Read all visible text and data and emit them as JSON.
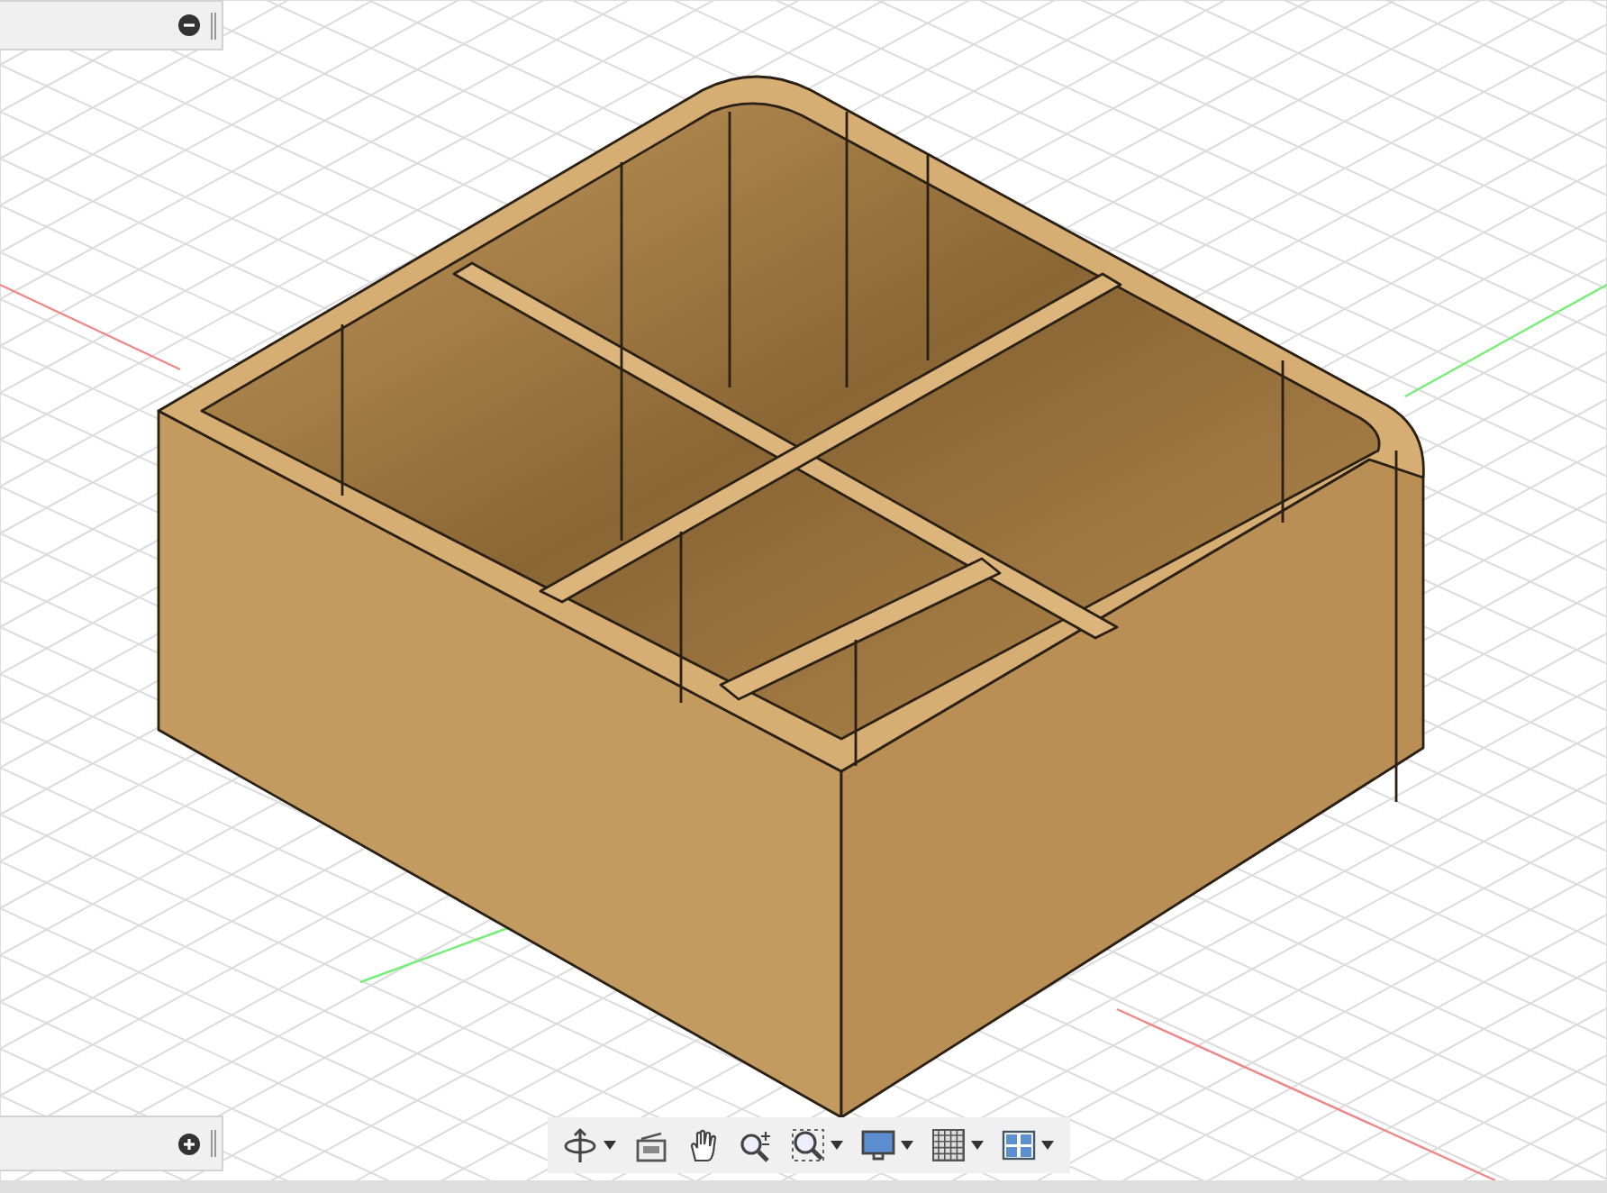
{
  "panels": [
    {
      "expanded": true
    },
    {
      "expanded": false
    }
  ],
  "toolbar": {
    "tools": [
      {
        "kind": "orbit",
        "has_menu": true
      },
      {
        "kind": "look_at",
        "has_menu": false
      },
      {
        "kind": "pan",
        "has_menu": false
      },
      {
        "kind": "zoom",
        "has_menu": false
      },
      {
        "kind": "fit",
        "has_menu": true
      },
      {
        "kind": "display",
        "has_menu": true
      },
      {
        "kind": "grid",
        "has_menu": true
      },
      {
        "kind": "viewports",
        "has_menu": true
      }
    ]
  }
}
